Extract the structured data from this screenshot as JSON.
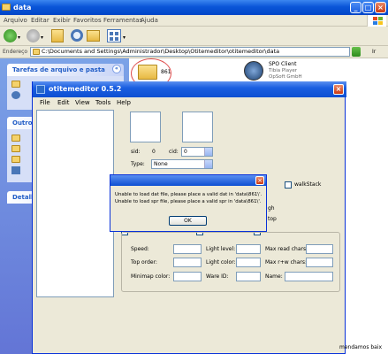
{
  "explorer": {
    "title": "data",
    "menu": [
      "Arquivo",
      "Editar",
      "Exibir",
      "Favoritos",
      "Ferramentas",
      "Ajuda"
    ],
    "address_label": "Endereço",
    "address": "C:\\Documents and Settings\\Administrador\\Desktop\\Otitemeditor\\otitemeditor\\data",
    "go_label": "Ir",
    "tasks_header": "Tarefas de arquivo e pasta",
    "other_header": "Outro",
    "details_header": "Detalh",
    "folder_name": "861",
    "spo": {
      "name": "SPO Client",
      "desc": "Tibia Player",
      "company": "OpSoft GmbH"
    }
  },
  "otitemeditor": {
    "title": "otitemeditor 0.5.2",
    "menu": [
      "File",
      "Edit",
      "View",
      "Tools",
      "Help"
    ],
    "sid_label": "sid:",
    "sid_value": "0",
    "cid_label": "cid:",
    "cid_value": "0",
    "type_label": "Type:",
    "type_value": "None",
    "walkstack_label": "walkStack",
    "partial_labels": [
      "gh",
      "top"
    ],
    "props": {
      "speed": "Speed:",
      "light_level": "Light level:",
      "max_read_chars": "Max read chars:",
      "top_order": "Top order:",
      "light_color": "Light color:",
      "max_write_chars": "Max r+w chars:",
      "minimap_color": "Minimap color:",
      "ware_id": "Ware ID:",
      "name": "Name:"
    }
  },
  "dialog": {
    "message_1": "Unable to load dat file, please place a valid dat in 'data\\861\\'.",
    "message_2": "Unable to load spr file, please place a valid spr in 'data\\861\\'.",
    "ok_label": "OK"
  },
  "tray_text": "mendamos baix"
}
